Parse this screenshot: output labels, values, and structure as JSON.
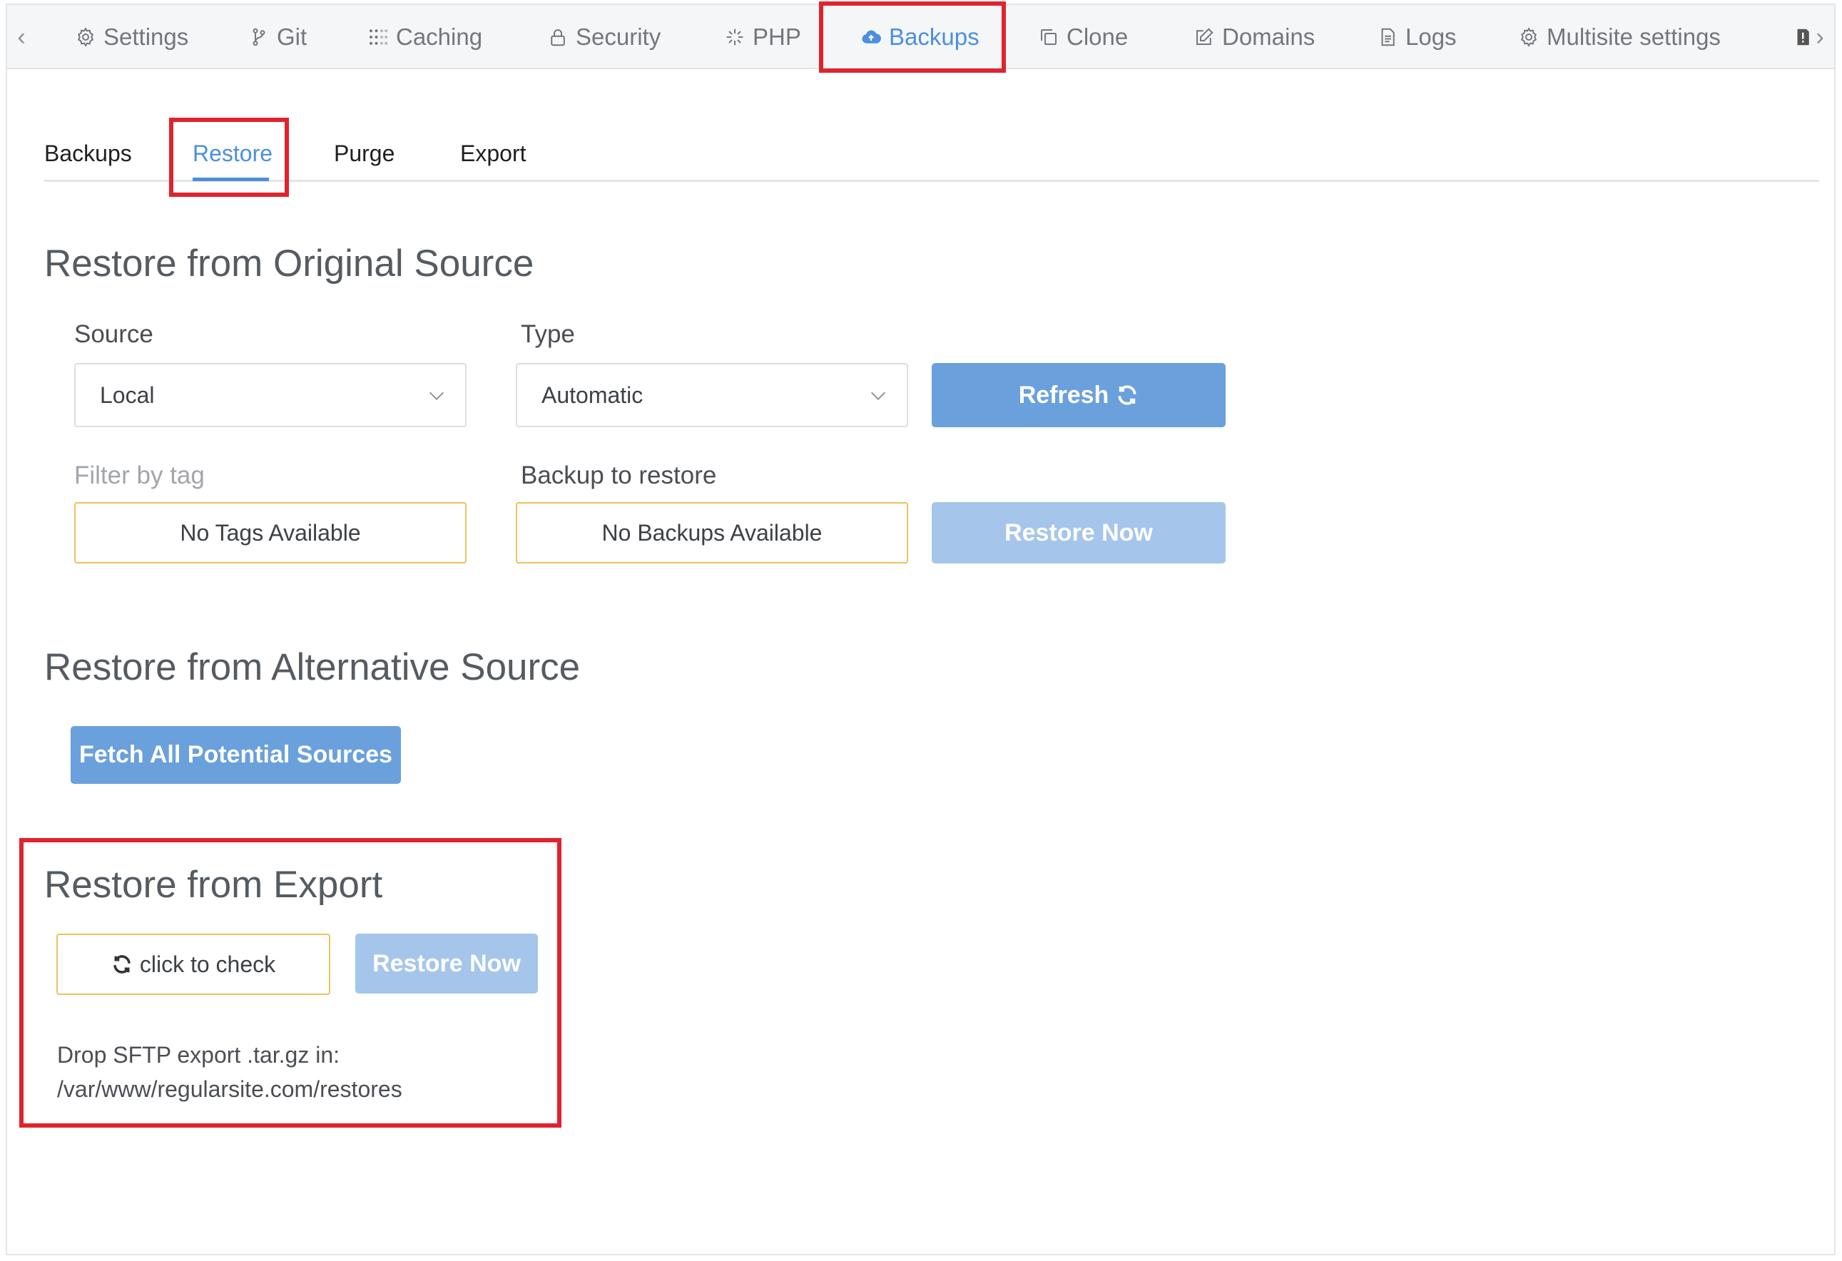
{
  "topnav": {
    "tabs": [
      {
        "label": "Settings",
        "icon": "gear-icon"
      },
      {
        "label": "Git",
        "icon": "git-branch-icon"
      },
      {
        "label": "Caching",
        "icon": "grid-dots-icon"
      },
      {
        "label": "Security",
        "icon": "lock-icon"
      },
      {
        "label": "PHP",
        "icon": "sparkle-icon"
      },
      {
        "label": "Backups",
        "icon": "cloud-upload-icon",
        "active": true
      },
      {
        "label": "Clone",
        "icon": "copy-icon"
      },
      {
        "label": "Domains",
        "icon": "edit-icon"
      },
      {
        "label": "Logs",
        "icon": "file-icon"
      },
      {
        "label": "Multisite settings",
        "icon": "gear-icon"
      }
    ]
  },
  "subtabs": {
    "items": [
      {
        "label": "Backups"
      },
      {
        "label": "Restore",
        "active": true
      },
      {
        "label": "Purge"
      },
      {
        "label": "Export"
      }
    ]
  },
  "original": {
    "heading": "Restore from Original Source",
    "source_label": "Source",
    "source_value": "Local",
    "type_label": "Type",
    "type_value": "Automatic",
    "refresh_label": "Refresh",
    "tag_label": "Filter by tag",
    "tag_value": "No Tags Available",
    "backup_label": "Backup to restore",
    "backup_value": "No Backups Available",
    "restore_label": "Restore Now"
  },
  "alternative": {
    "heading": "Restore from Alternative Source",
    "fetch_label": "Fetch All Potential Sources"
  },
  "export": {
    "heading": "Restore from Export",
    "check_label": "click to check",
    "restore_label": "Restore Now",
    "note_line1": "Drop SFTP export .tar.gz in:",
    "note_line2": "/var/www/regularsite.com/restores"
  },
  "colors": {
    "accent": "#4b8fe0",
    "button": "#6aa0dc",
    "button_disabled": "#a5c6ea",
    "highlight": "#e0232d",
    "warning_border": "#ecc35a"
  }
}
